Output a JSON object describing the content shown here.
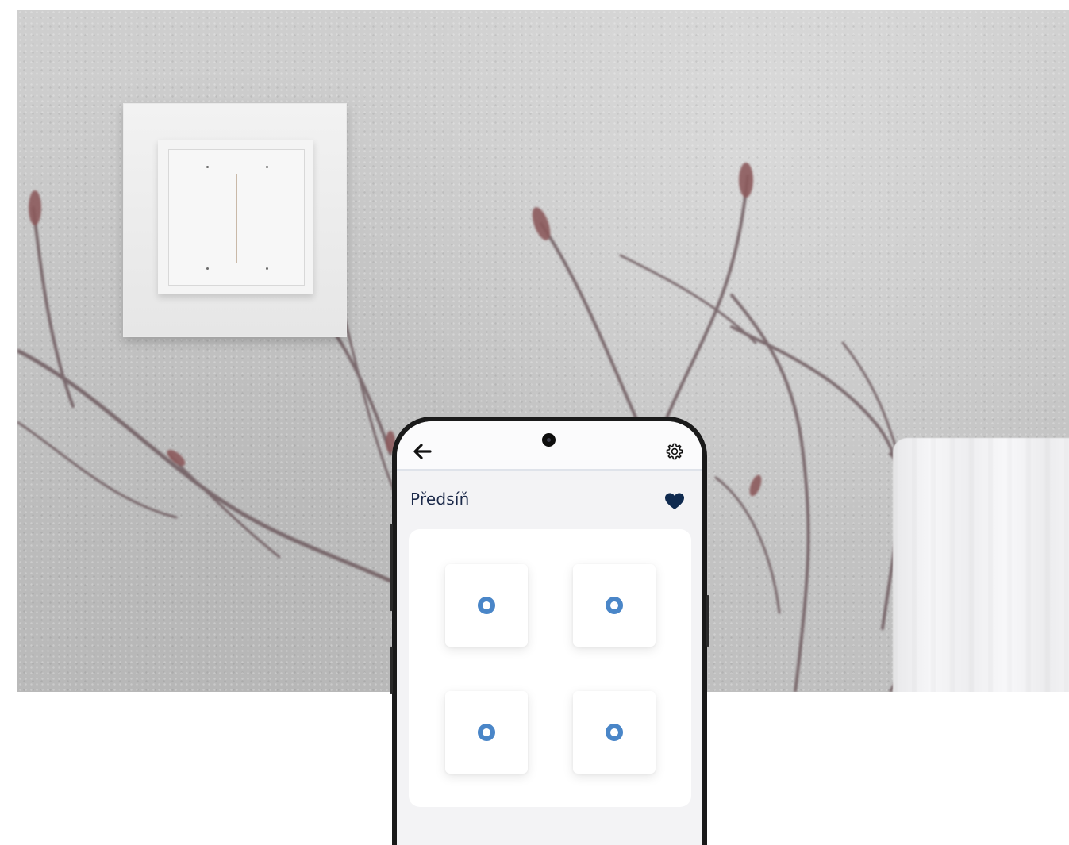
{
  "room": {
    "title": "Předsíň"
  },
  "icons": {
    "back": "arrow-left-icon",
    "settings": "gear-icon",
    "favorite": "heart-icon",
    "key_indicator": "ring-indicator-icon"
  },
  "colors": {
    "accent": "#4a86c8",
    "title_text": "#1c2a4a",
    "heart": "#0f2a4f"
  },
  "switch_keys": [
    {
      "position": "top-left"
    },
    {
      "position": "top-right"
    },
    {
      "position": "bottom-left"
    },
    {
      "position": "bottom-right"
    }
  ]
}
